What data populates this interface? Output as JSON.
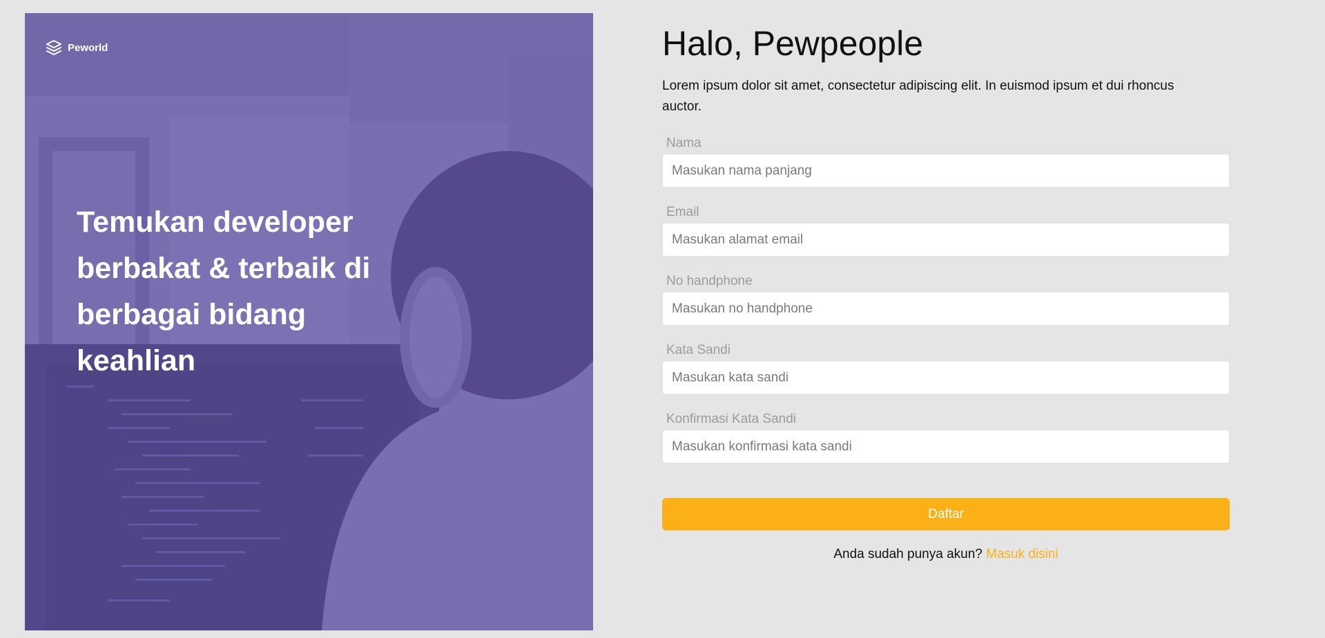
{
  "brand": {
    "name": "Peworld",
    "icon": "layers-icon"
  },
  "hero": {
    "headline": "Temukan developer berbakat & terbaik di berbagai bidang keahlian"
  },
  "form": {
    "title": "Halo, Pewpeople",
    "description": "Lorem ipsum dolor sit amet, consectetur adipiscing elit. In euismod ipsum et dui rhoncus auctor.",
    "fields": [
      {
        "label": "Nama",
        "placeholder": "Masukan nama panjang",
        "value": ""
      },
      {
        "label": "Email",
        "placeholder": "Masukan alamat email",
        "value": ""
      },
      {
        "label": "No handphone",
        "placeholder": "Masukan no handphone",
        "value": ""
      },
      {
        "label": "Kata Sandi",
        "placeholder": "Masukan kata sandi",
        "value": ""
      },
      {
        "label": "Konfirmasi Kata Sandi",
        "placeholder": "Masukan konfirmasi kata sandi",
        "value": ""
      }
    ],
    "submit_label": "Daftar",
    "login_prompt": "Anda sudah punya akun?",
    "login_link": "Masuk disini"
  },
  "colors": {
    "accent": "#fbb017",
    "hero_overlay": "#5e50a1",
    "background": "#e5e5e5"
  }
}
